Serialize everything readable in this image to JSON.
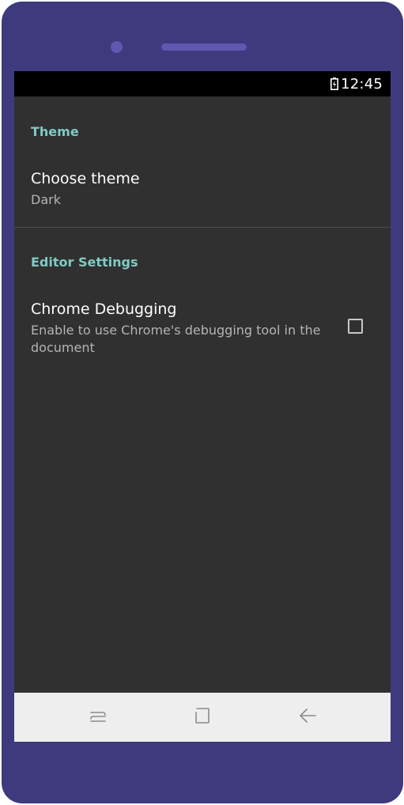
{
  "status_bar": {
    "time": "12:45",
    "battery_icon": "battery-charging-icon"
  },
  "preferences": {
    "theme_category": "Theme",
    "choose_theme": {
      "title": "Choose theme",
      "summary": "Dark"
    },
    "editor_category": "Editor Settings",
    "chrome_debugging": {
      "title": "Chrome Debugging",
      "summary": "Enable to use Chrome's debugging tool in the document",
      "checked": false
    }
  },
  "nav_bar": {
    "recents_icon": "recents-icon",
    "home_icon": "home-icon",
    "back_icon": "back-arrow-icon"
  },
  "colors": {
    "device_frame": "#3e3a7d",
    "screen_background": "#303030",
    "category_accent": "#7fcbc4",
    "nav_background": "#eeeeee"
  }
}
